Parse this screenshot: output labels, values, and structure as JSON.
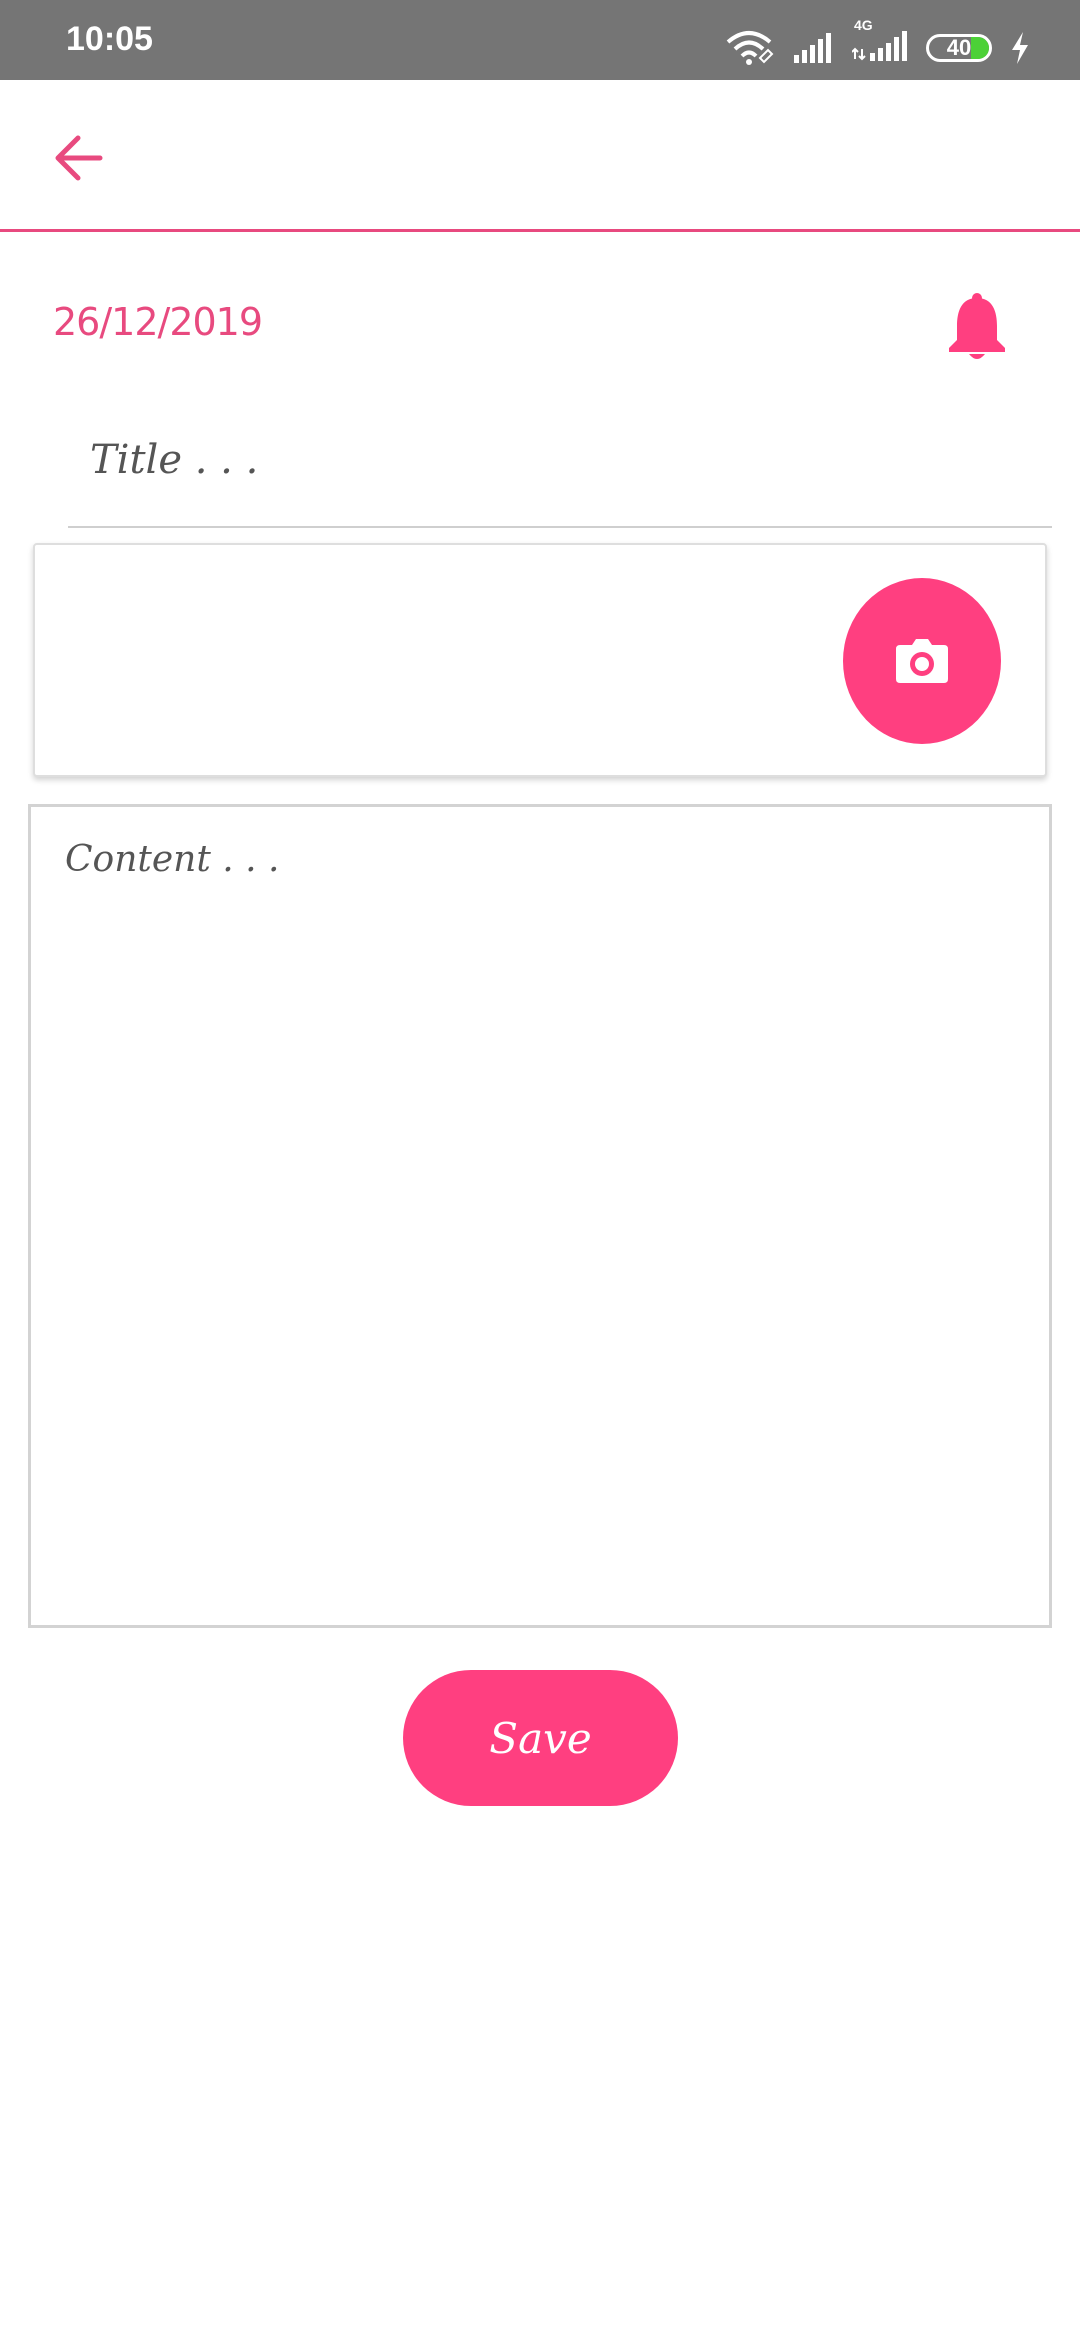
{
  "status_bar": {
    "time": "10:05",
    "network": "4G",
    "battery": "40",
    "icons": [
      "wifi-icon",
      "signal-icon",
      "signal-4g-icon",
      "battery-icon",
      "charging-icon"
    ]
  },
  "app_bar": {
    "back_icon": "arrow-left-icon"
  },
  "note": {
    "date": "26/12/2019",
    "reminder_icon": "bell-icon",
    "title_placeholder": "Title . . .",
    "title_value": "",
    "camera_icon": "camera-icon",
    "content_placeholder": "Content . . .",
    "content_value": ""
  },
  "actions": {
    "save_label": "Save"
  },
  "colors": {
    "accent": "#FF3F80",
    "accent_text": "#E84A7F",
    "status_bar": "#757575",
    "battery_green": "#4CD137"
  }
}
